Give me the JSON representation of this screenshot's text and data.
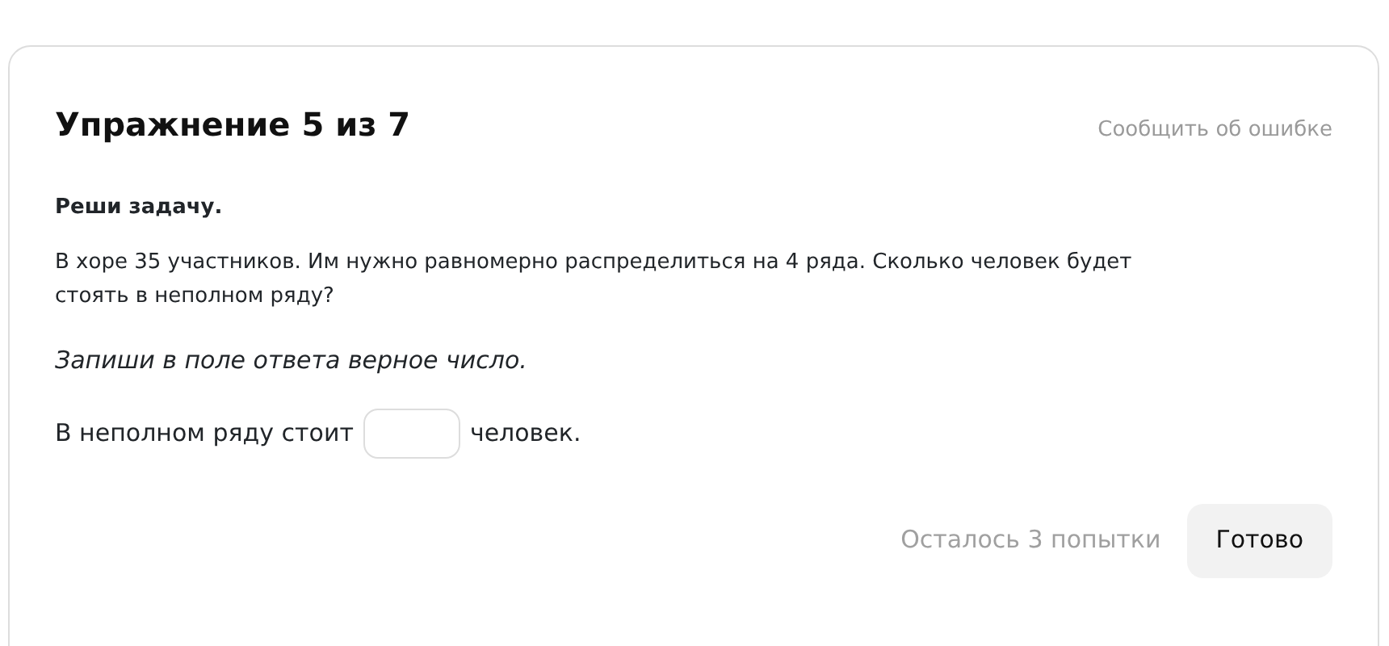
{
  "exercise": {
    "title": "Упражнение 5 из 7",
    "report_link": "Сообщить об ошибке"
  },
  "task": {
    "heading": "Реши задачу.",
    "text": "В хоре 35 участников. Им нужно равномерно распределиться на 4 ряда. Сколько человек будет стоять в неполном ряду?",
    "instruction": "Запиши в поле ответа верное число."
  },
  "answer": {
    "before": "В неполном ряду стоит",
    "after": "человек."
  },
  "footer": {
    "attempts": "Осталось 3 попытки",
    "submit": "Готово"
  }
}
